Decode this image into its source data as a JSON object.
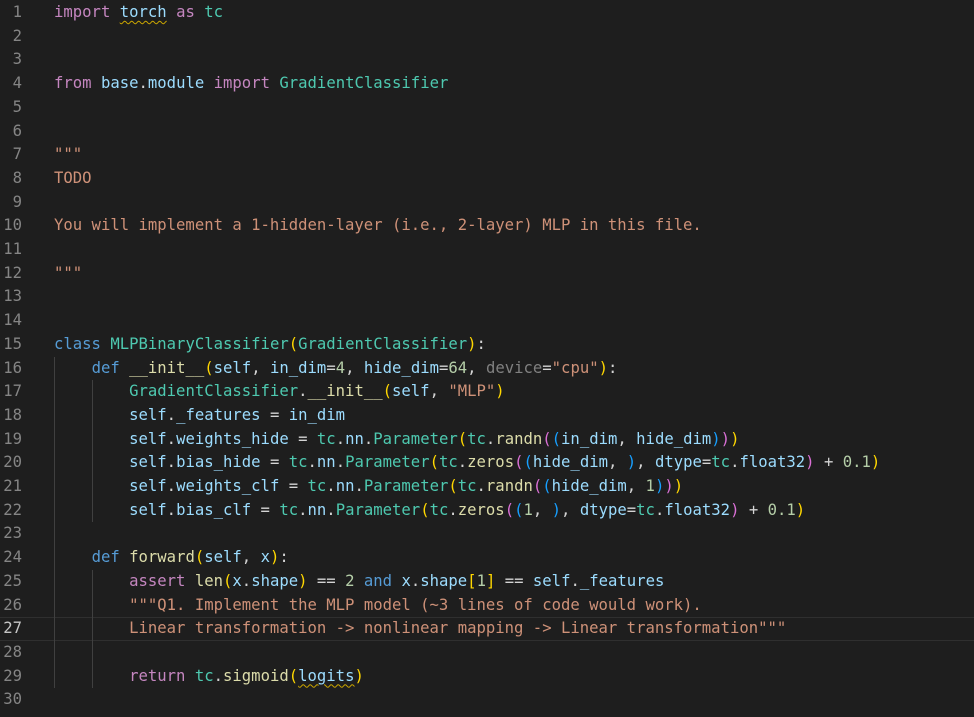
{
  "current_line": 27,
  "guides": [
    {
      "indent": 1,
      "from": 16,
      "to": 29
    },
    {
      "indent": 2,
      "from": 17,
      "to": 22
    },
    {
      "indent": 2,
      "from": 25,
      "to": 29
    }
  ],
  "lines": [
    {
      "n": "1",
      "tokens": [
        [
          "import",
          "ctl"
        ],
        [
          " ",
          "text"
        ],
        [
          "torch",
          "var",
          "squig"
        ],
        [
          " ",
          "text"
        ],
        [
          "as",
          "ctl"
        ],
        [
          " ",
          "text"
        ],
        [
          "tc",
          "cls"
        ]
      ]
    },
    {
      "n": "2",
      "tokens": []
    },
    {
      "n": "3",
      "tokens": []
    },
    {
      "n": "4",
      "tokens": [
        [
          "from",
          "ctl"
        ],
        [
          " ",
          "text"
        ],
        [
          "base",
          "var"
        ],
        [
          ".",
          "op"
        ],
        [
          "module",
          "var"
        ],
        [
          " ",
          "text"
        ],
        [
          "import",
          "ctl"
        ],
        [
          " ",
          "text"
        ],
        [
          "GradientClassifier",
          "cls"
        ]
      ]
    },
    {
      "n": "5",
      "tokens": []
    },
    {
      "n": "6",
      "tokens": []
    },
    {
      "n": "7",
      "tokens": [
        [
          "\"\"\"",
          "str"
        ]
      ]
    },
    {
      "n": "8",
      "tokens": [
        [
          "TODO",
          "str"
        ]
      ]
    },
    {
      "n": "9",
      "tokens": []
    },
    {
      "n": "10",
      "tokens": [
        [
          "You will implement a 1-hidden-layer (i.e., 2-layer) MLP in this file.",
          "str"
        ]
      ]
    },
    {
      "n": "11",
      "tokens": []
    },
    {
      "n": "12",
      "tokens": [
        [
          "\"\"\"",
          "str"
        ]
      ]
    },
    {
      "n": "13",
      "tokens": []
    },
    {
      "n": "14",
      "tokens": []
    },
    {
      "n": "15",
      "tokens": [
        [
          "class",
          "kw"
        ],
        [
          " ",
          "text"
        ],
        [
          "MLPBinaryClassifier",
          "cls"
        ],
        [
          "(",
          "p1"
        ],
        [
          "GradientClassifier",
          "cls"
        ],
        [
          ")",
          "p1"
        ],
        [
          ":",
          "text"
        ]
      ]
    },
    {
      "n": "16",
      "tokens": [
        [
          "    ",
          "text"
        ],
        [
          "def",
          "kw"
        ],
        [
          " ",
          "text"
        ],
        [
          "__init__",
          "fn"
        ],
        [
          "(",
          "p1"
        ],
        [
          "self",
          "self"
        ],
        [
          ", ",
          "text"
        ],
        [
          "in_dim",
          "param"
        ],
        [
          "=",
          "op"
        ],
        [
          "4",
          "num"
        ],
        [
          ", ",
          "text"
        ],
        [
          "hide_dim",
          "param"
        ],
        [
          "=",
          "op"
        ],
        [
          "64",
          "num"
        ],
        [
          ", ",
          "text"
        ],
        [
          "device",
          "muted"
        ],
        [
          "=",
          "op"
        ],
        [
          "\"cpu\"",
          "str"
        ],
        [
          ")",
          "p1"
        ],
        [
          ":",
          "text"
        ]
      ]
    },
    {
      "n": "17",
      "tokens": [
        [
          "        ",
          "text"
        ],
        [
          "GradientClassifier",
          "cls"
        ],
        [
          ".",
          "op"
        ],
        [
          "__init__",
          "fn"
        ],
        [
          "(",
          "p1"
        ],
        [
          "self",
          "self"
        ],
        [
          ", ",
          "text"
        ],
        [
          "\"MLP\"",
          "str"
        ],
        [
          ")",
          "p1"
        ]
      ]
    },
    {
      "n": "18",
      "tokens": [
        [
          "        ",
          "text"
        ],
        [
          "self",
          "self"
        ],
        [
          ".",
          "op"
        ],
        [
          "_features",
          "var"
        ],
        [
          " = ",
          "op"
        ],
        [
          "in_dim",
          "param"
        ]
      ]
    },
    {
      "n": "19",
      "tokens": [
        [
          "        ",
          "text"
        ],
        [
          "self",
          "self"
        ],
        [
          ".",
          "op"
        ],
        [
          "weights_hide",
          "var"
        ],
        [
          " = ",
          "op"
        ],
        [
          "tc",
          "cls"
        ],
        [
          ".",
          "op"
        ],
        [
          "nn",
          "var"
        ],
        [
          ".",
          "op"
        ],
        [
          "Parameter",
          "cls"
        ],
        [
          "(",
          "p1"
        ],
        [
          "tc",
          "cls"
        ],
        [
          ".",
          "op"
        ],
        [
          "randn",
          "fn"
        ],
        [
          "(",
          "p2"
        ],
        [
          "(",
          "p3"
        ],
        [
          "in_dim",
          "param"
        ],
        [
          ", ",
          "text"
        ],
        [
          "hide_dim",
          "param"
        ],
        [
          ")",
          "p3"
        ],
        [
          ")",
          "p2"
        ],
        [
          ")",
          "p1"
        ]
      ]
    },
    {
      "n": "20",
      "tokens": [
        [
          "        ",
          "text"
        ],
        [
          "self",
          "self"
        ],
        [
          ".",
          "op"
        ],
        [
          "bias_hide",
          "var"
        ],
        [
          " = ",
          "op"
        ],
        [
          "tc",
          "cls"
        ],
        [
          ".",
          "op"
        ],
        [
          "nn",
          "var"
        ],
        [
          ".",
          "op"
        ],
        [
          "Parameter",
          "cls"
        ],
        [
          "(",
          "p1"
        ],
        [
          "tc",
          "cls"
        ],
        [
          ".",
          "op"
        ],
        [
          "zeros",
          "fn"
        ],
        [
          "(",
          "p2"
        ],
        [
          "(",
          "p3"
        ],
        [
          "hide_dim",
          "param"
        ],
        [
          ", ",
          "text"
        ],
        [
          ")",
          "p3"
        ],
        [
          ", ",
          "text"
        ],
        [
          "dtype",
          "param"
        ],
        [
          "=",
          "op"
        ],
        [
          "tc",
          "cls"
        ],
        [
          ".",
          "op"
        ],
        [
          "float32",
          "var"
        ],
        [
          ")",
          "p2"
        ],
        [
          " + ",
          "op"
        ],
        [
          "0.1",
          "num"
        ],
        [
          ")",
          "p1"
        ]
      ]
    },
    {
      "n": "21",
      "tokens": [
        [
          "        ",
          "text"
        ],
        [
          "self",
          "self"
        ],
        [
          ".",
          "op"
        ],
        [
          "weights_clf",
          "var"
        ],
        [
          " = ",
          "op"
        ],
        [
          "tc",
          "cls"
        ],
        [
          ".",
          "op"
        ],
        [
          "nn",
          "var"
        ],
        [
          ".",
          "op"
        ],
        [
          "Parameter",
          "cls"
        ],
        [
          "(",
          "p1"
        ],
        [
          "tc",
          "cls"
        ],
        [
          ".",
          "op"
        ],
        [
          "randn",
          "fn"
        ],
        [
          "(",
          "p2"
        ],
        [
          "(",
          "p3"
        ],
        [
          "hide_dim",
          "param"
        ],
        [
          ", ",
          "text"
        ],
        [
          "1",
          "num"
        ],
        [
          ")",
          "p3"
        ],
        [
          ")",
          "p2"
        ],
        [
          ")",
          "p1"
        ]
      ]
    },
    {
      "n": "22",
      "tokens": [
        [
          "        ",
          "text"
        ],
        [
          "self",
          "self"
        ],
        [
          ".",
          "op"
        ],
        [
          "bias_clf",
          "var"
        ],
        [
          " = ",
          "op"
        ],
        [
          "tc",
          "cls"
        ],
        [
          ".",
          "op"
        ],
        [
          "nn",
          "var"
        ],
        [
          ".",
          "op"
        ],
        [
          "Parameter",
          "cls"
        ],
        [
          "(",
          "p1"
        ],
        [
          "tc",
          "cls"
        ],
        [
          ".",
          "op"
        ],
        [
          "zeros",
          "fn"
        ],
        [
          "(",
          "p2"
        ],
        [
          "(",
          "p3"
        ],
        [
          "1",
          "num"
        ],
        [
          ", ",
          "text"
        ],
        [
          ")",
          "p3"
        ],
        [
          ", ",
          "text"
        ],
        [
          "dtype",
          "param"
        ],
        [
          "=",
          "op"
        ],
        [
          "tc",
          "cls"
        ],
        [
          ".",
          "op"
        ],
        [
          "float32",
          "var"
        ],
        [
          ")",
          "p2"
        ],
        [
          " + ",
          "op"
        ],
        [
          "0.1",
          "num"
        ],
        [
          ")",
          "p1"
        ]
      ]
    },
    {
      "n": "23",
      "tokens": []
    },
    {
      "n": "24",
      "tokens": [
        [
          "    ",
          "text"
        ],
        [
          "def",
          "kw"
        ],
        [
          " ",
          "text"
        ],
        [
          "forward",
          "fn"
        ],
        [
          "(",
          "p1"
        ],
        [
          "self",
          "self"
        ],
        [
          ", ",
          "text"
        ],
        [
          "x",
          "param"
        ],
        [
          ")",
          "p1"
        ],
        [
          ":",
          "text"
        ]
      ]
    },
    {
      "n": "25",
      "tokens": [
        [
          "        ",
          "text"
        ],
        [
          "assert",
          "ctl"
        ],
        [
          " ",
          "text"
        ],
        [
          "len",
          "fn"
        ],
        [
          "(",
          "p1"
        ],
        [
          "x",
          "param"
        ],
        [
          ".",
          "op"
        ],
        [
          "shape",
          "var"
        ],
        [
          ")",
          "p1"
        ],
        [
          " == ",
          "op"
        ],
        [
          "2",
          "num"
        ],
        [
          " ",
          "text"
        ],
        [
          "and",
          "kw"
        ],
        [
          " ",
          "text"
        ],
        [
          "x",
          "param"
        ],
        [
          ".",
          "op"
        ],
        [
          "shape",
          "var"
        ],
        [
          "[",
          "p1"
        ],
        [
          "1",
          "num"
        ],
        [
          "]",
          "p1"
        ],
        [
          " == ",
          "op"
        ],
        [
          "self",
          "self"
        ],
        [
          ".",
          "op"
        ],
        [
          "_features",
          "var"
        ]
      ]
    },
    {
      "n": "26",
      "tokens": [
        [
          "        ",
          "text"
        ],
        [
          "\"\"\"Q1. Implement the MLP model (~3 lines of code would work).",
          "str"
        ]
      ]
    },
    {
      "n": "27",
      "tokens": [
        [
          "        ",
          "text"
        ],
        [
          "Linear transformation -> nonlinear mapping -> Linear transformation\"\"\"",
          "str"
        ]
      ]
    },
    {
      "n": "28",
      "tokens": []
    },
    {
      "n": "29",
      "tokens": [
        [
          "        ",
          "text"
        ],
        [
          "return",
          "ctl"
        ],
        [
          " ",
          "text"
        ],
        [
          "tc",
          "cls"
        ],
        [
          ".",
          "op"
        ],
        [
          "sigmoid",
          "fn"
        ],
        [
          "(",
          "p1"
        ],
        [
          "logits",
          "var",
          "squig"
        ],
        [
          ")",
          "p1"
        ]
      ]
    },
    {
      "n": "30",
      "tokens": []
    }
  ]
}
